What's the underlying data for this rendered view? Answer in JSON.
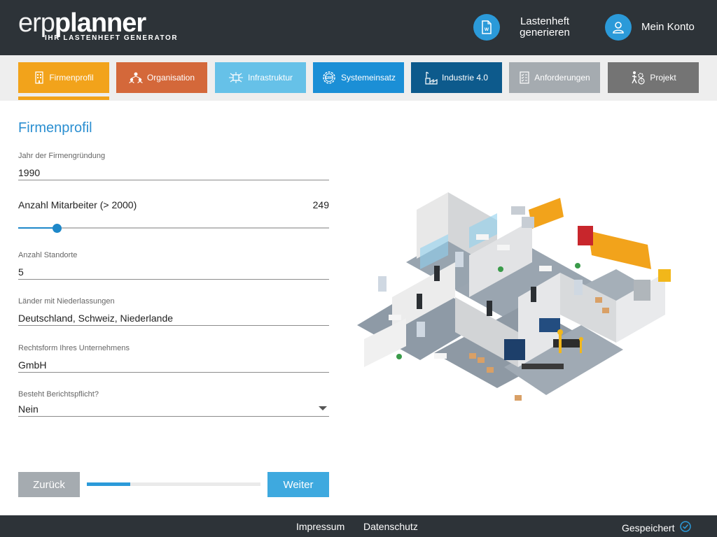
{
  "header": {
    "logo_thin": "erp",
    "logo_bold": "planner",
    "logo_sub": "IHR LASTENHEFT GENERATOR",
    "generate_label": "Lastenheft\ngenerieren",
    "generate_icon": "word-document-icon",
    "account_label": "Mein Konto",
    "account_icon": "user-icon"
  },
  "tabs": [
    {
      "label": "Firmenprofil",
      "icon": "building-icon",
      "color": "#f2a31b",
      "active": true
    },
    {
      "label": "Organisation",
      "icon": "org-people-icon",
      "color": "#d4683a",
      "active": false
    },
    {
      "label": "Infrastruktur",
      "icon": "network-icon",
      "color": "#66c1e8",
      "active": false
    },
    {
      "label": "Systemeinsatz",
      "icon": "erp-gear-icon",
      "color": "#1b8fd6",
      "active": false
    },
    {
      "label": "Industrie 4.0",
      "icon": "factory-icon",
      "color": "#0d5a8c",
      "active": false
    },
    {
      "label": "Anforderungen",
      "icon": "checklist-icon",
      "color": "#a5abb0",
      "active": false
    },
    {
      "label": "Projekt",
      "icon": "project-gear-icon",
      "color": "#747474",
      "active": false
    }
  ],
  "form": {
    "title": "Firmenprofil",
    "founding_year": {
      "label": "Jahr der Firmengründung",
      "value": "1990"
    },
    "employees": {
      "label": "Anzahl Mitarbeiter (> 2000)",
      "value": "249",
      "fraction": 0.125
    },
    "locations": {
      "label": "Anzahl Standorte",
      "value": "5"
    },
    "countries": {
      "label": "Länder mit Niederlassungen",
      "value": "Deutschland, Schweiz, Niederlande"
    },
    "legal_form": {
      "label": "Rechtsform Ihres Unternehmens",
      "value": "GmbH"
    },
    "reporting": {
      "label": "Besteht Berichtspflicht?",
      "value": "Nein"
    }
  },
  "nav": {
    "back_label": "Zurück",
    "next_label": "Weiter",
    "progress": 0.25
  },
  "footer": {
    "impressum": "Impressum",
    "datenschutz": "Datenschutz",
    "saved_label": "Gespeichert",
    "saved_icon": "check-circle-icon"
  },
  "colors": {
    "header_bg": "#2d3338",
    "accent_blue": "#2b8fd1",
    "button_next": "#3ea9df",
    "button_back": "#a5abb0"
  }
}
